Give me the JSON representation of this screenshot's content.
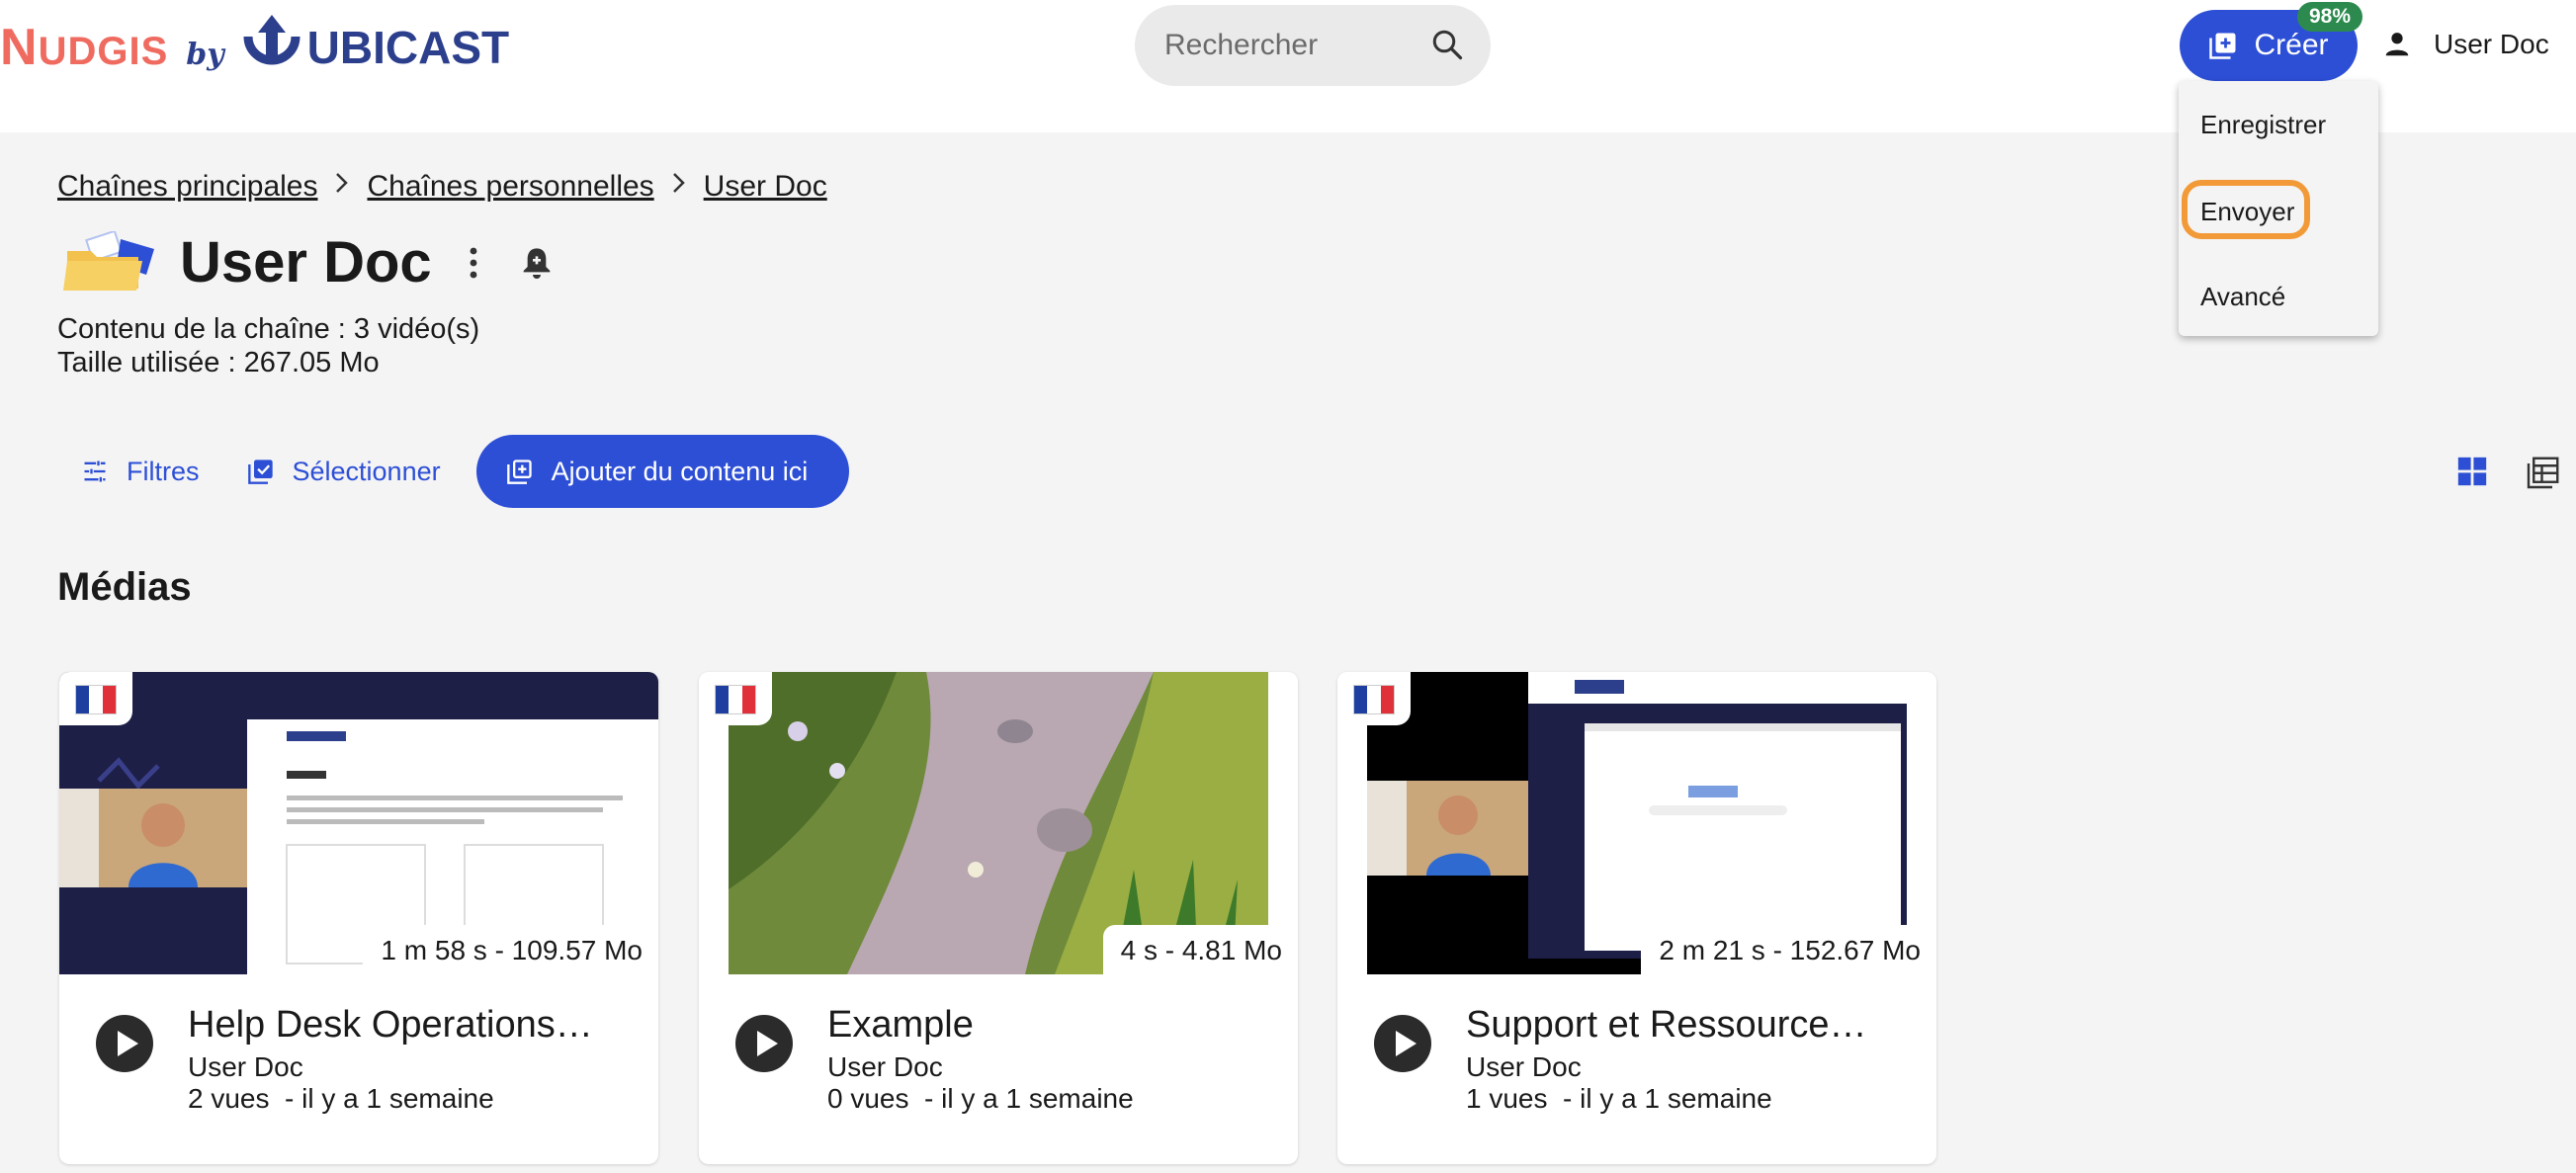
{
  "header": {
    "logo": {
      "part1": "N",
      "part2": "UDGIS",
      "by": "by",
      "brand": "UBICAST"
    },
    "search_placeholder": "Rechercher",
    "create_label": "Créer",
    "quota_badge": "98%",
    "user_name": "User Doc"
  },
  "create_menu": {
    "items": [
      "Enregistrer",
      "Envoyer",
      "Avancé"
    ],
    "highlighted": "Envoyer"
  },
  "breadcrumb": [
    "Chaînes principales",
    "Chaînes personnelles",
    "User Doc"
  ],
  "channel": {
    "title": "User Doc",
    "content_line": "Contenu de la chaîne : 3 vidéo(s)",
    "size_line": "Taille utilisée : 267.05 Mo"
  },
  "toolbar": {
    "filters": "Filtres",
    "select": "Sélectionner",
    "add": "Ajouter du contenu ici"
  },
  "section_title": "Médias",
  "colors": {
    "accent": "#2d4fd6",
    "brand": "#2c3f8c",
    "logo_coral": "#ef6b5f",
    "badge": "#2c8a4e",
    "highlight": "#f29a37"
  },
  "media": [
    {
      "title": "Help Desk Operations…",
      "author": "User Doc",
      "meta": "2 vues  - il y a 1 semaine",
      "duration": "1 m 58 s - 109.57 Mo",
      "language_flag": "fr-flag"
    },
    {
      "title": "Example",
      "author": "User Doc",
      "meta": "0 vues  - il y a 1 semaine",
      "duration": "4 s - 4.81 Mo",
      "language_flag": "fr-flag"
    },
    {
      "title": "Support et Ressource…",
      "author": "User Doc",
      "meta": "1 vues  - il y a 1 semaine",
      "duration": "2 m 21 s - 152.67 Mo",
      "language_flag": "fr-flag"
    }
  ]
}
